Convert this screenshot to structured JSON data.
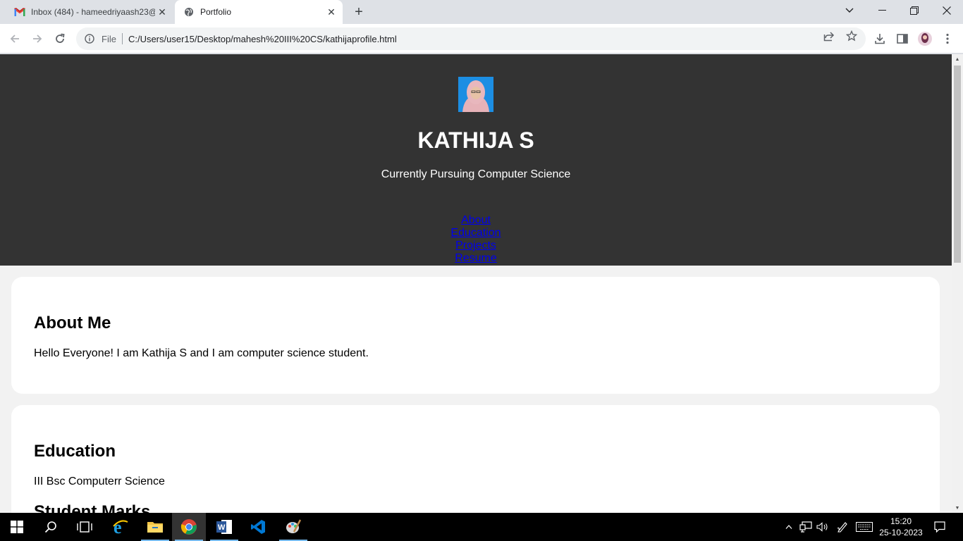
{
  "browser": {
    "tabs": [
      {
        "title": "Inbox (484) - hameedriyaash23@",
        "favicon": "gmail-icon",
        "active": false
      },
      {
        "title": "Portfolio",
        "favicon": "globe-icon",
        "active": true
      }
    ],
    "omnibox": {
      "scheme_label": "File",
      "url": "C:/Users/user15/Desktop/mahesh%20III%20CS/kathijaprofile.html"
    }
  },
  "page": {
    "header": {
      "name": "KATHIJA S",
      "tagline": "Currently Pursuing Computer Science",
      "nav": [
        "About",
        "Education",
        "Projects",
        "Resume"
      ]
    },
    "about": {
      "heading": "About Me",
      "text": "Hello Everyone! I am Kathija S and I am computer science student."
    },
    "education": {
      "heading": "Education",
      "text": "III Bsc Computerr Science",
      "subheading": "Student Marks"
    }
  },
  "taskbar": {
    "time": "15:20",
    "date": "25-10-2023"
  },
  "colors": {
    "header_bg": "#333333",
    "page_bg": "#f2f2f2",
    "link": "#0000ee"
  }
}
